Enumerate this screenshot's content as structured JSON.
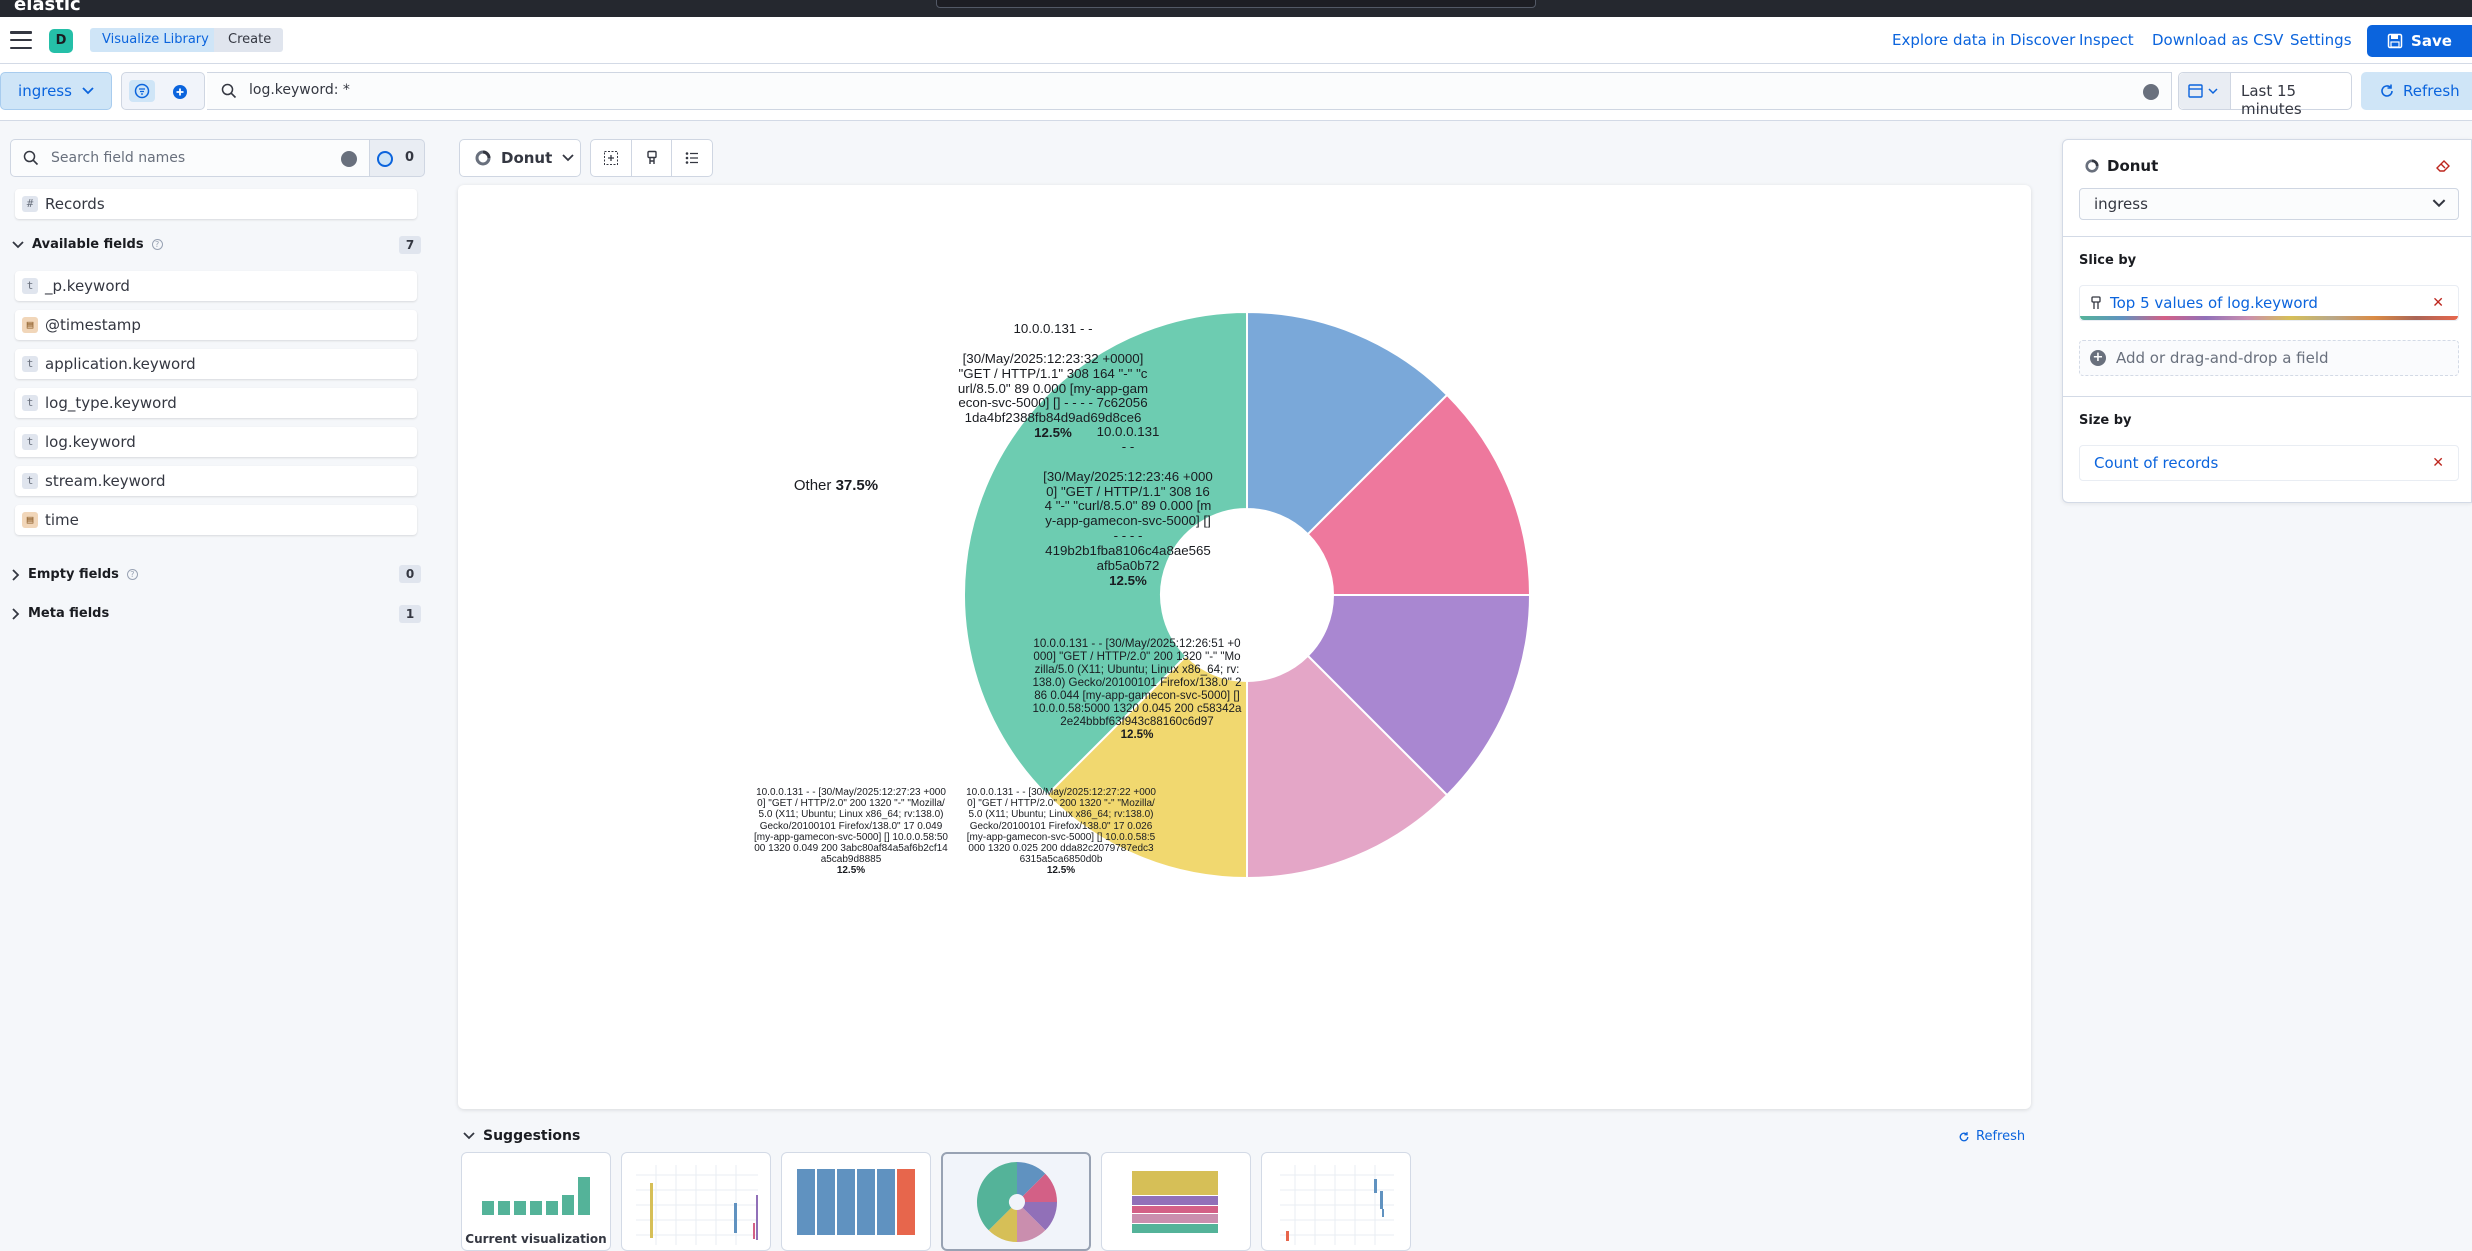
{
  "app": {
    "logo_text": "elastic"
  },
  "header": {
    "space_initial": "D",
    "breadcrumbs": [
      "Visualize Library",
      "Create"
    ],
    "links": [
      "Explore data in Discover",
      "Inspect",
      "Download as CSV",
      "Settings"
    ],
    "save_label": "Save"
  },
  "querybar": {
    "data_view": "ingress",
    "query": "log.keyword: *",
    "time_range": "Last 15 minutes",
    "refresh_label": "Refresh"
  },
  "fields_panel": {
    "search_placeholder": "Search field names",
    "filter_count": "0",
    "records_label": "Records",
    "available_label": "Available fields",
    "available_count": "7",
    "fields": [
      {
        "name": "_p.keyword",
        "type": "t"
      },
      {
        "name": "@timestamp",
        "type": "date"
      },
      {
        "name": "application.keyword",
        "type": "t"
      },
      {
        "name": "log_type.keyword",
        "type": "t"
      },
      {
        "name": "log.keyword",
        "type": "t"
      },
      {
        "name": "stream.keyword",
        "type": "t"
      },
      {
        "name": "time",
        "type": "date"
      }
    ],
    "empty_label": "Empty fields",
    "empty_count": "0",
    "meta_label": "Meta fields",
    "meta_count": "1"
  },
  "toolbar": {
    "chart_type": "Donut"
  },
  "chart_data": {
    "type": "pie",
    "donut": true,
    "slices": [
      {
        "label_main": "10.0.0.131 - -\n\n[30/May/2025:12:23:32 +0000] \"GET / HTTP/1.1\" 308 164 \"-\" \"curl/8.5.0\" 89 0.000 [my-app-gamecon-svc-5000] [] - - - - 7c620561da4bf2388fb84d9ad69d8ce6",
        "value": 12.5,
        "pct_label": "12.5%",
        "color": "#7aa8d9"
      },
      {
        "label_main": "10.0.0.131\n- -\n\n[30/May/2025:12:23:46 +0000] \"GET / HTTP/1.1\" 308 164 \"-\" \"curl/8.5.0\" 89 0.000 [my-app-gamecon-svc-5000] [] - - - -\n419b2b1fba8106c4a8ae565afb5a0b72",
        "value": 12.5,
        "pct_label": "12.5%",
        "color": "#ee789d"
      },
      {
        "label_main": "10.0.0.131 - - [30/May/2025:12:26:51 +0000] \"GET / HTTP/2.0\" 200 1320 \"-\" \"Mozilla/5.0 (X11; Ubuntu; Linux x86_64; rv:138.0) Gecko/20100101 Firefox/138.0\" 286 0.044 [my-app-gamecon-svc-5000] [] 10.0.0.58:5000 1320 0.045 200 c58342a2e24bbbf63f943c88160c6d97",
        "value": 12.5,
        "pct_label": "12.5%",
        "color": "#a987d1"
      },
      {
        "label_main": "10.0.0.131 - - [30/May/2025:12:27:22 +0000] \"GET / HTTP/2.0\" 200 1320 \"-\" \"Mozilla/5.0 (X11; Ubuntu; Linux x86_64; rv:138.0) Gecko/20100101 Firefox/138.0\" 17 0.026 [my-app-gamecon-svc-5000] [] 10.0.0.58:5000 1320 0.025 200 dda82c2079787edc36315a5ca6850d0b",
        "value": 12.5,
        "pct_label": "12.5%",
        "color": "#e4a6c7"
      },
      {
        "label_main": "10.0.0.131 - - [30/May/2025:12:27:23 +0000] \"GET / HTTP/2.0\" 200 1320 \"-\" \"Mozilla/5.0 (X11; Ubuntu; Linux x86_64; rv:138.0) Gecko/20100101 Firefox/138.0\" 17 0.049 [my-app-gamecon-svc-5000] [] 10.0.0.58:5000 1320 0.049 200 3abc80af84a5af6b2cf14a5cab9d8885",
        "value": 12.5,
        "pct_label": "12.5%",
        "color": "#f1d86f"
      },
      {
        "label_main": "Other",
        "value": 37.5,
        "pct_label": "37.5%",
        "color": "#6dccb1"
      }
    ]
  },
  "suggestions": {
    "title": "Suggestions",
    "refresh_label": "Refresh",
    "items": [
      {
        "caption": "Current visualization"
      },
      {
        "caption": ""
      },
      {
        "caption": ""
      },
      {
        "caption": ""
      },
      {
        "caption": ""
      },
      {
        "caption": ""
      }
    ]
  },
  "config": {
    "title": "Donut",
    "data_view": "ingress",
    "slice_by_label": "Slice by",
    "slice_by_value": "Top 5 values of log.keyword",
    "add_field_label": "Add or drag-and-drop a field",
    "size_by_label": "Size by",
    "size_by_value": "Count of records"
  }
}
